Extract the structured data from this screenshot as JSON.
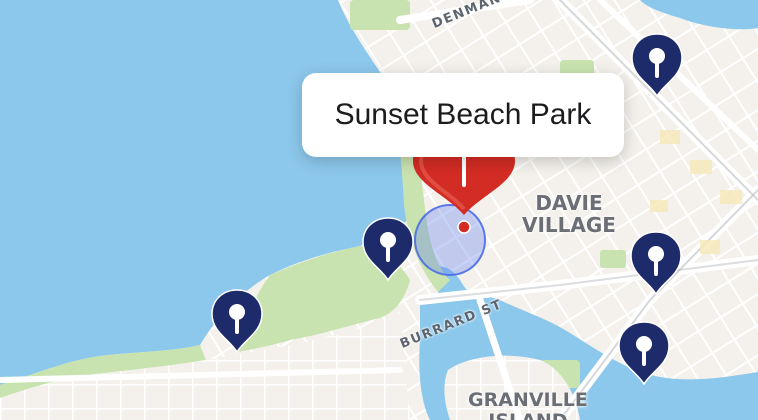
{
  "map": {
    "selected_place": {
      "title": "Sunset Beach Park"
    },
    "street_labels": [
      "DENMAN",
      "BURRARD ST"
    ],
    "area_labels": {
      "davie_village": [
        "DAVIE",
        "VILLAGE"
      ],
      "granville_island": [
        "GRANVILLE",
        "ISLAND"
      ]
    },
    "pins": [
      {
        "name": "map-pin-top-right",
        "icon": "map-pin-icon"
      },
      {
        "name": "map-pin-beach",
        "icon": "map-pin-icon"
      },
      {
        "name": "map-pin-west-end",
        "icon": "map-pin-icon"
      },
      {
        "name": "map-pin-east-middle",
        "icon": "map-pin-icon"
      },
      {
        "name": "map-pin-east-lower",
        "icon": "map-pin-icon"
      }
    ],
    "colors": {
      "water": "#8cc8ec",
      "land": "#f2efe9",
      "park": "#c9e3b0",
      "pin": "#1e2b6a",
      "selected_pin": "#d32c24",
      "location_ring": "#5b7cf0"
    }
  }
}
